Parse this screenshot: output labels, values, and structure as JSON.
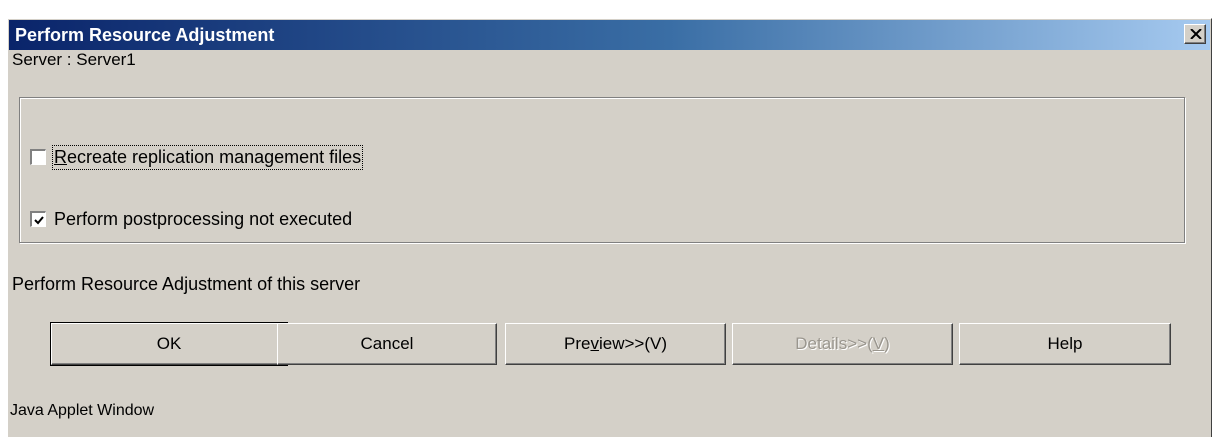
{
  "window": {
    "title": "Perform Resource Adjustment",
    "close_label": "Close"
  },
  "server": {
    "label": "Server : Server1"
  },
  "options": {
    "recreate_files": {
      "label_before": "",
      "mnemonic": "R",
      "label_after": "ecreate replication management files",
      "checked": false
    },
    "postprocessing": {
      "label": "Perform postprocessing not executed",
      "checked": true
    }
  },
  "message": "Perform Resource Adjustment of this server",
  "buttons": {
    "ok": "OK",
    "cancel": "Cancel",
    "preview": {
      "before": "Pre",
      "mnemonic": "v",
      "after": "iew>>(V)"
    },
    "details": {
      "before": "Details>>(",
      "mnemonic": "V",
      "after": ")",
      "disabled": true
    },
    "help": "Help"
  },
  "footer": "Java Applet Window",
  "colors": {
    "title_start": "#0a246a",
    "title_end": "#a6caf0",
    "face": "#d4d0c8"
  }
}
